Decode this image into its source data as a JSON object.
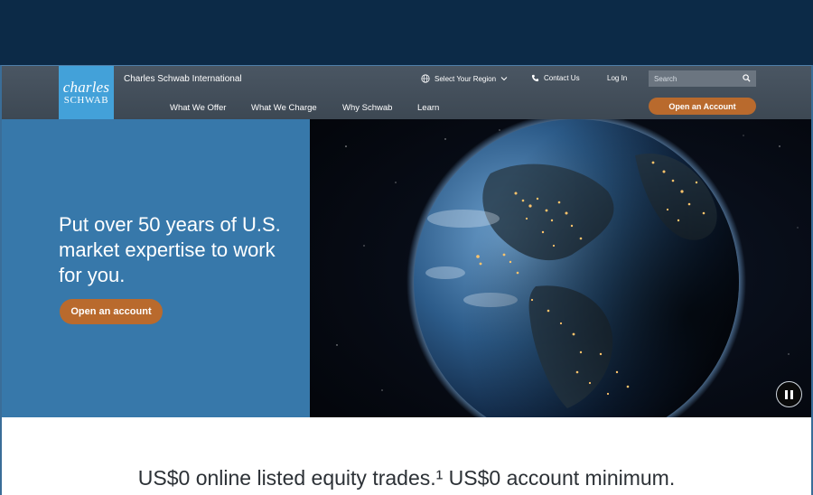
{
  "header": {
    "logo_line1": "charles",
    "logo_line2": "SCHWAB",
    "brand": "Charles Schwab International",
    "region": "Select Your Region",
    "contact": "Contact Us",
    "login": "Log In",
    "search_placeholder": "Search",
    "open_account": "Open an Account",
    "nav": [
      "What We Offer",
      "What We Charge",
      "Why Schwab",
      "Learn"
    ]
  },
  "hero": {
    "title": "Put over 50 years of U.S. market expertise to work for you.",
    "cta": "Open an account"
  },
  "promo": {
    "text": "US$0 online listed equity trades.¹ US$0 account minimum."
  },
  "colors": {
    "page_bg": "#0c2a47",
    "header_bg": "#444f5b",
    "logo_bg": "#43a1d9",
    "hero_blue": "#3778aa",
    "cta_orange": "#b96a2d"
  },
  "icons": {
    "region": "globe-icon",
    "region_dropdown": "chevron-down-icon",
    "contact": "phone-icon",
    "search": "search-icon",
    "media": "pause-icon"
  }
}
